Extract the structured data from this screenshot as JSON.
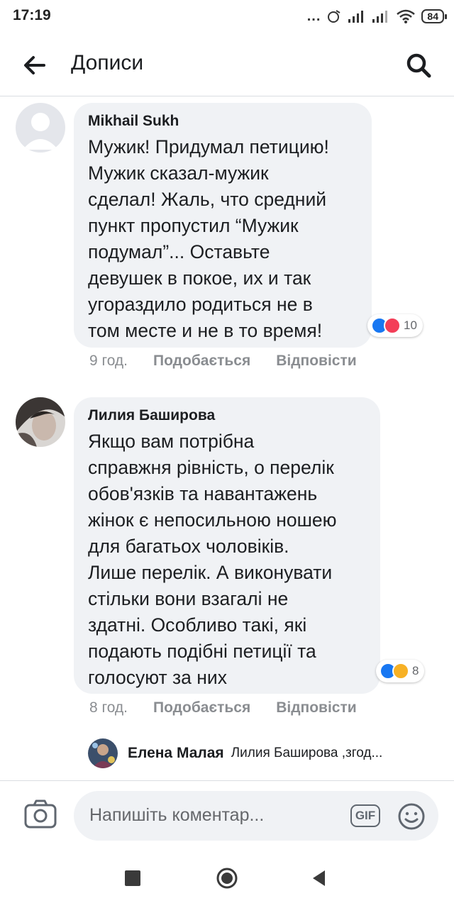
{
  "status_bar": {
    "time": "17:19",
    "dots": "...",
    "battery": "84"
  },
  "header": {
    "title": "Дописи",
    "back_icon": "arrow-left-icon",
    "search_icon": "search-icon"
  },
  "comments": [
    {
      "author": "Mikhail Sukh",
      "text": "Мужик! Придумал петицию!\nМужик сказал-мужик\nсделал! Жаль, что средний\nпункт пропустил “Мужик\nподумал”... Оставьте\nдевушек в покое, их и так\nугораздило родиться не в\nтом месте и не в то время!",
      "reactions": [
        "like",
        "love"
      ],
      "reaction_count": "10",
      "time": "9 год.",
      "like_label": "Подобається",
      "reply_label": "Відповісти"
    },
    {
      "author": "Лилия Баширова",
      "text": "Якщо вам потрібна\nсправжня рівність,  о перелік\nобов'язків та навантажень\nжінок є непосильною ношею\nдля багатьох чоловіків.\nЛише перелік. А виконувати\nстільки вони взагалі не\nздатні. Особливо такі, які\nподають подібні петиції та\nголосуют за них",
      "reactions": [
        "like",
        "haha"
      ],
      "reaction_count": "8",
      "time": "8 год.",
      "like_label": "Подобається",
      "reply_label": "Відповісти"
    }
  ],
  "reply_preview": {
    "author": "Елена Малая",
    "text": "Лилия Баширова ,згод..."
  },
  "composer": {
    "placeholder": "Напишіть коментар...",
    "gif_label": "GIF",
    "camera_icon": "camera-icon",
    "emoji_icon": "smiley-icon"
  },
  "colors": {
    "bubble": "#f0f2f5",
    "like": "#1877f2",
    "love": "#f33e58",
    "haha": "#f7b125",
    "meta": "#8a8d91"
  }
}
